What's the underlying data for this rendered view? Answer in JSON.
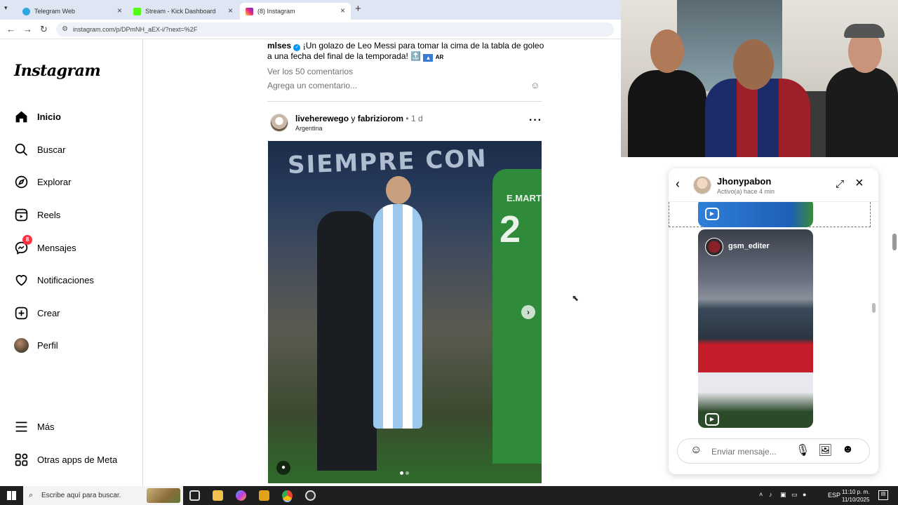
{
  "browser": {
    "tabs": [
      {
        "title": "Telegram Web",
        "color": "#2ea6e0"
      },
      {
        "title": "Stream - Kick Dashboard",
        "color": "#53fc18"
      },
      {
        "title": "(8) Instagram",
        "color": "#d6249f"
      }
    ],
    "active_tab": 2,
    "url": "instagram.com/p/DPmNH_aEX-i/?next=%2F"
  },
  "sidebar": {
    "logo": "Instagram",
    "items": [
      {
        "label": "Inicio",
        "icon": "home-icon"
      },
      {
        "label": "Buscar",
        "icon": "search-icon"
      },
      {
        "label": "Explorar",
        "icon": "compass-icon"
      },
      {
        "label": "Reels",
        "icon": "reels-icon"
      },
      {
        "label": "Mensajes",
        "icon": "messenger-icon",
        "badge": "8"
      },
      {
        "label": "Notificaciones",
        "icon": "heart-icon"
      },
      {
        "label": "Crear",
        "icon": "plus-square-icon"
      },
      {
        "label": "Perfil",
        "icon": "avatar"
      }
    ],
    "more": "Más",
    "meta_apps": "Otras apps de Meta"
  },
  "feed": {
    "prev_post": {
      "username": "mlses",
      "caption": "¡Un golazo de Leo Messi para tomar la cima de la tabla de goleo a una fecha del final de la temporada! 🔝",
      "flag": "AR",
      "comments_link": "Ver los 50 comentarios",
      "comment_placeholder": "Agrega un comentario..."
    },
    "post": {
      "author1": "liveherewego",
      "joiner": "y",
      "author2": "fabriziorom",
      "time": "• 1 d",
      "location": "Argentina",
      "image_banner": "SIEMPRE CON",
      "green_player_name": "E.MART",
      "green_player_number": "2",
      "carousel_index": 1,
      "carousel_total": 2
    }
  },
  "dm": {
    "name": "Jhonypabon",
    "status": "Activo(a) hace 4 min",
    "reel_user": "gsm_editer",
    "input_placeholder": "Enviar mensaje..."
  },
  "taskbar": {
    "search_placeholder": "Escribe aquí para buscar.",
    "language": "ESP",
    "time": "11:10 p. m.",
    "date": "11/10/2025"
  }
}
